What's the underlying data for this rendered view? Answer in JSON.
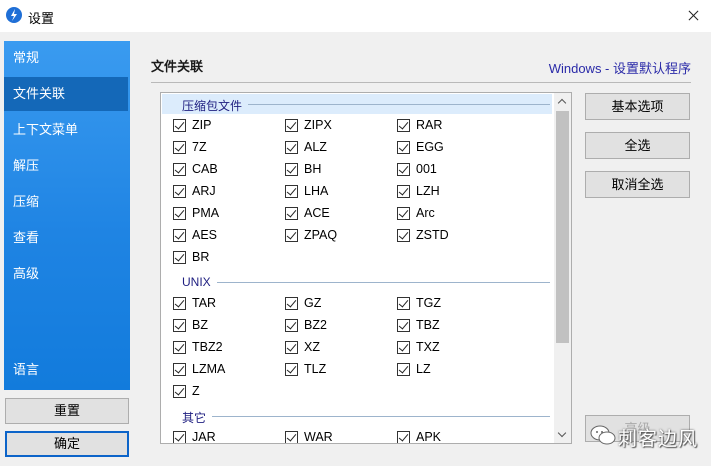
{
  "window": {
    "title": "设置",
    "close_icon": "close-icon",
    "app_icon": "app-logo-icon"
  },
  "sidebar": {
    "items": [
      {
        "label": "常规",
        "active": false
      },
      {
        "label": "文件关联",
        "active": true
      },
      {
        "label": "上下文菜单",
        "active": false
      },
      {
        "label": "解压",
        "active": false
      },
      {
        "label": "压缩",
        "active": false
      },
      {
        "label": "查看",
        "active": false
      },
      {
        "label": "高级",
        "active": false
      }
    ],
    "language_label": "语言",
    "accent_color": "#1f84e3"
  },
  "footer": {
    "reset_label": "重置",
    "ok_label": "确定"
  },
  "main": {
    "section_title": "文件关联",
    "windows_link": "Windows - 设置默认程序",
    "buttons": {
      "basic_options": "基本选项",
      "select_all": "全选",
      "deselect_all": "取消全选",
      "partial_hidden": "高级"
    },
    "groups": [
      {
        "title": "压缩包文件",
        "items": [
          "ZIP",
          "ZIPX",
          "RAR",
          "7Z",
          "ALZ",
          "EGG",
          "CAB",
          "BH",
          "001",
          "ARJ",
          "LHA",
          "LZH",
          "PMA",
          "ACE",
          "Arc",
          "AES",
          "ZPAQ",
          "ZSTD",
          "BR"
        ]
      },
      {
        "title": "UNIX",
        "items": [
          "TAR",
          "GZ",
          "TGZ",
          "BZ",
          "BZ2",
          "TBZ",
          "TBZ2",
          "XZ",
          "TXZ",
          "LZMA",
          "TLZ",
          "LZ",
          "Z"
        ]
      },
      {
        "title": "其它",
        "items": [
          "JAR",
          "WAR",
          "APK"
        ]
      }
    ]
  },
  "watermark": {
    "text": "刺客边风"
  }
}
